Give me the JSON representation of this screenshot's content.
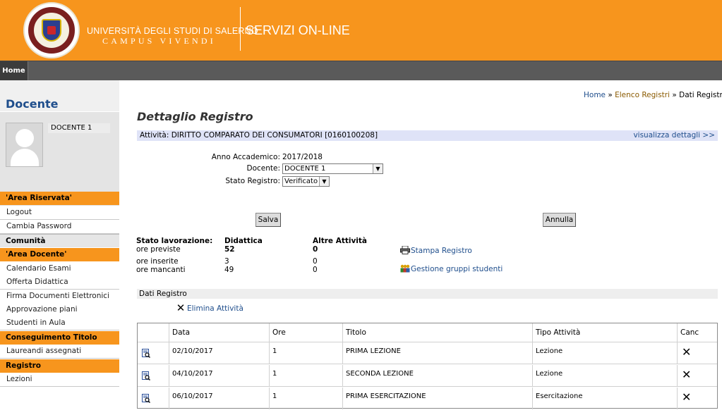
{
  "header": {
    "university": "UNIVERSITÀ DEGLI STUDI DI SALERNO",
    "motto": "CAMPUS VIVENDI",
    "services": "SERVIZI ON-LINE"
  },
  "nav": {
    "home": "Home"
  },
  "sidebar": {
    "docente_title": "Docente",
    "docente_name": "DOCENTE 1",
    "sections": {
      "area_riservata": "'Area Riservata'",
      "logout": "Logout",
      "cambia_password": "Cambia Password",
      "comunita": "Comunità",
      "area_docente": "'Area Docente'",
      "calendario_esami": "Calendario Esami",
      "offerta_didattica": "Offerta Didattica",
      "firma_documenti": "Firma Documenti Elettronici",
      "approvazione_piani": "Approvazione piani",
      "studenti_in_aula": "Studenti in Aula",
      "conseguimento_titolo": "Conseguimento Titolo",
      "laureandi_assegnati": "Laureandi assegnati",
      "registro": "Registro",
      "lezioni": "Lezioni"
    }
  },
  "breadcrumb": {
    "home": "Home",
    "sep1": " » ",
    "elenco": "Elenco Registri",
    "sep2": " » ",
    "current": "Dati Registro"
  },
  "page_title": "Dettaglio Registro",
  "activity": {
    "label": "Attività: DIRITTO COMPARATO DEI CONSUMATORI [0160100208]",
    "details_link": "visualizza dettagli >>"
  },
  "form": {
    "anno_label": "Anno Accademico:",
    "anno_value": "2017/2018",
    "docente_label": "Docente:",
    "docente_value": "DOCENTE 1",
    "stato_label": "Stato Registro:",
    "stato_value": "Verificato"
  },
  "buttons": {
    "salva": "Salva",
    "annulla": "Annulla"
  },
  "stato": {
    "header_label": "Stato lavorazione:",
    "col_didattica": "Didattica",
    "col_altre": "Altre Attività",
    "ore_previste": "ore previste",
    "ore_inserite": "ore inserite",
    "ore_mancanti": "ore mancanti",
    "didattica_previste": "52",
    "didattica_inserite": "3",
    "didattica_mancanti": "49",
    "altre_previste": "0",
    "altre_inserite": "0",
    "altre_mancanti": "0"
  },
  "links": {
    "stampa": "Stampa Registro",
    "gestione": "Gestione gruppi studenti"
  },
  "dati_registro": "Dati Registro",
  "elimina": "Elimina Attività",
  "table": {
    "headers": [
      "Data",
      "Ore",
      "Titolo",
      "Tipo Attività",
      "Canc"
    ],
    "rows": [
      {
        "data": "02/10/2017",
        "ore": "1",
        "titolo": "PRIMA LEZIONE",
        "tipo": "Lezione"
      },
      {
        "data": "04/10/2017",
        "ore": "1",
        "titolo": "SECONDA LEZIONE",
        "tipo": "Lezione"
      },
      {
        "data": "06/10/2017",
        "ore": "1",
        "titolo": "PRIMA ESERCITAZIONE",
        "tipo": "Esercitazione"
      }
    ]
  }
}
